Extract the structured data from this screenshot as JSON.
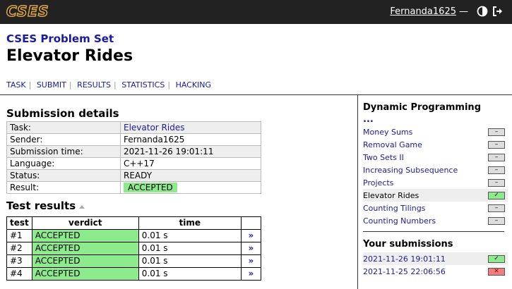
{
  "header": {
    "logo": "CSES",
    "username": "Fernanda1625",
    "dash": "—"
  },
  "course": "CSES Problem Set",
  "title": "Elevator Rides",
  "tabs": [
    "TASK",
    "SUBMIT",
    "RESULTS",
    "STATISTICS",
    "HACKING"
  ],
  "tab_separator": "|",
  "submission": {
    "heading": "Submission details",
    "rows": [
      {
        "label": "Task:",
        "value": "Elevator Rides"
      },
      {
        "label": "Sender:",
        "value": "Fernanda1625"
      },
      {
        "label": "Submission time:",
        "value": "2021-11-26 19:01:11"
      },
      {
        "label": "Language:",
        "value": "C++17"
      },
      {
        "label": "Status:",
        "value": "READY"
      },
      {
        "label": "Result:",
        "value": "ACCEPTED"
      }
    ]
  },
  "tests": {
    "heading": "Test results",
    "columns": [
      "test",
      "verdict",
      "time",
      ""
    ],
    "rows": [
      {
        "test": "#1",
        "verdict": "ACCEPTED",
        "time": "0.01 s",
        "link": "»"
      },
      {
        "test": "#2",
        "verdict": "ACCEPTED",
        "time": "0.01 s",
        "link": "»"
      },
      {
        "test": "#3",
        "verdict": "ACCEPTED",
        "time": "0.01 s",
        "link": "»"
      },
      {
        "test": "#4",
        "verdict": "ACCEPTED",
        "time": "0.01 s",
        "link": "»"
      }
    ]
  },
  "sidebar": {
    "title": "Dynamic Programming",
    "ellipsis": "...",
    "items": [
      {
        "label": "Money Sums",
        "badge": "–",
        "status": "none"
      },
      {
        "label": "Removal Game",
        "badge": "–",
        "status": "none"
      },
      {
        "label": "Two Sets II",
        "badge": "–",
        "status": "none"
      },
      {
        "label": "Increasing Subsequence",
        "badge": "–",
        "status": "none"
      },
      {
        "label": "Projects",
        "badge": "–",
        "status": "none"
      },
      {
        "label": "Elevator Rides",
        "badge": "✓",
        "status": "ok"
      },
      {
        "label": "Counting Tilings",
        "badge": "–",
        "status": "none"
      },
      {
        "label": "Counting Numbers",
        "badge": "–",
        "status": "none"
      }
    ],
    "submissions_title": "Your submissions",
    "submissions": [
      {
        "time": "2021-11-26 19:01:11",
        "badge": "✓",
        "status": "ok"
      },
      {
        "time": "2021-11-25 22:06:56",
        "badge": "✕",
        "status": "fail"
      }
    ]
  },
  "colors": {
    "topbar": "#222222",
    "accepted": "#8dea8d",
    "link": "#1a1a9c",
    "fail": "#f08080"
  },
  "icons": [
    "contrast-icon",
    "logout-icon",
    "sort-up-icon"
  ]
}
